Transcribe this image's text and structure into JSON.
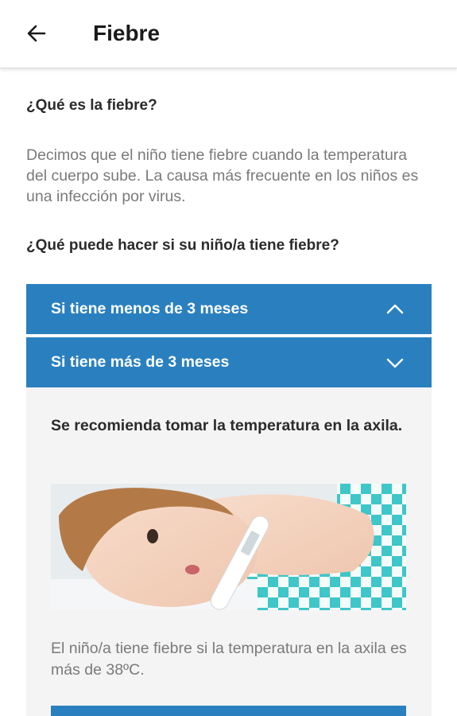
{
  "app_bar": {
    "back_icon": "arrow-left-icon",
    "title": "Fiebre"
  },
  "content": {
    "question_what": "¿Qué es la fiebre?",
    "intro_text": "Decimos que el niño tiene fiebre cuando la temperatura del cuerpo sube. La causa más frecuente en los niños es una infección por virus.",
    "question_action": "¿Qué puede hacer si su niño/a tiene fiebre?",
    "accordion": [
      {
        "label": "Si tiene menos de 3 meses",
        "icon": "chevron-up-icon"
      },
      {
        "label": "Si tiene más de 3 meses",
        "icon": "chevron-down-icon"
      }
    ],
    "panel": {
      "recommendation": "Se recomienda tomar la temperatura en la axila.",
      "image_icon": "baby-thermometer-photo",
      "result_text": "El niño/a tiene fiebre si la temperatura en la axila es más de 38ºC."
    }
  },
  "colors": {
    "accent": "#2a80bf",
    "panel_bg": "#f4f4f4",
    "body_text": "#7a7a7a",
    "heading_text": "#2b2b2b"
  }
}
